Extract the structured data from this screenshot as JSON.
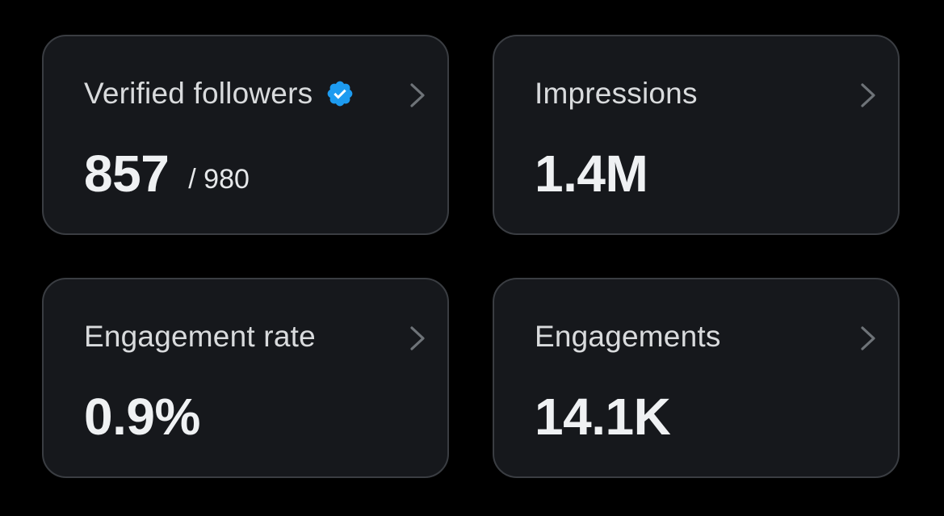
{
  "cards": [
    {
      "label": "Verified followers",
      "value": "857",
      "total": "/ 980",
      "icon": "verified-badge-icon"
    },
    {
      "label": "Impressions",
      "value": "1.4M"
    },
    {
      "label": "Engagement rate",
      "value": "0.9%"
    },
    {
      "label": "Engagements",
      "value": "14.1K"
    }
  ],
  "colors": {
    "background": "#000000",
    "card": "#16181c",
    "card_border": "#3a3d42",
    "label": "#d9dbdd",
    "value": "#eff1f3",
    "verified_badge": "#1d9bf0",
    "chevron": "#6e7378"
  }
}
